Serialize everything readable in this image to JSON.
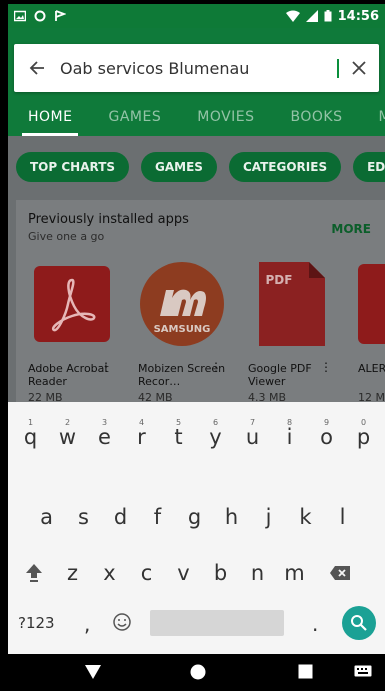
{
  "status": {
    "time": "14:56",
    "left_icons": [
      "gallery-icon",
      "circle-notification-icon",
      "flag-icon"
    ],
    "right_icons": [
      "wifi-icon",
      "lte-signal-icon",
      "battery-icon"
    ]
  },
  "search": {
    "query": "Oab servicos Blumenau",
    "back_icon": "back-arrow-icon",
    "clear_icon": "close-icon"
  },
  "tabs": [
    {
      "label": "HOME"
    },
    {
      "label": "GAMES"
    },
    {
      "label": "MOVIES"
    },
    {
      "label": "BOOKS"
    },
    {
      "label": "MU"
    }
  ],
  "chips": [
    {
      "label": "TOP CHARTS"
    },
    {
      "label": "GAMES"
    },
    {
      "label": "CATEGORIES"
    },
    {
      "label": "EDITO"
    }
  ],
  "section": {
    "title": "Previously installed apps",
    "subtitle": "Give one a go",
    "more": "MORE",
    "apps": [
      {
        "name": "Adobe Acrobat Reader",
        "size": "22 MB",
        "icon": "acrobat-icon"
      },
      {
        "name": "Mobizen Screen Recor…",
        "size": "42 MB",
        "icon": "mobizen-icon",
        "icon_text": "SAMSUNG"
      },
      {
        "name": "Google PDF Viewer",
        "size": "4.3 MB",
        "icon": "pdf-viewer-icon",
        "icon_text": "PDF"
      },
      {
        "name": "ALER",
        "size": "12 MI",
        "icon": "partial-app-icon"
      }
    ]
  },
  "keyboard": {
    "row1": [
      {
        "k": "q",
        "h": "1"
      },
      {
        "k": "w",
        "h": "2"
      },
      {
        "k": "e",
        "h": "3"
      },
      {
        "k": "r",
        "h": "4"
      },
      {
        "k": "t",
        "h": "5"
      },
      {
        "k": "y",
        "h": "6"
      },
      {
        "k": "u",
        "h": "7"
      },
      {
        "k": "i",
        "h": "8"
      },
      {
        "k": "o",
        "h": "9"
      },
      {
        "k": "p",
        "h": "0"
      }
    ],
    "row2": [
      "a",
      "s",
      "d",
      "f",
      "g",
      "h",
      "j",
      "k",
      "l"
    ],
    "row3": [
      "z",
      "x",
      "c",
      "v",
      "b",
      "n",
      "m"
    ],
    "symbols": "?123",
    "comma": ",",
    "period": "."
  },
  "colors": {
    "brand_green": "#0f7a3a",
    "chip_green": "#0b6b33",
    "search_button": "#1ba195"
  }
}
